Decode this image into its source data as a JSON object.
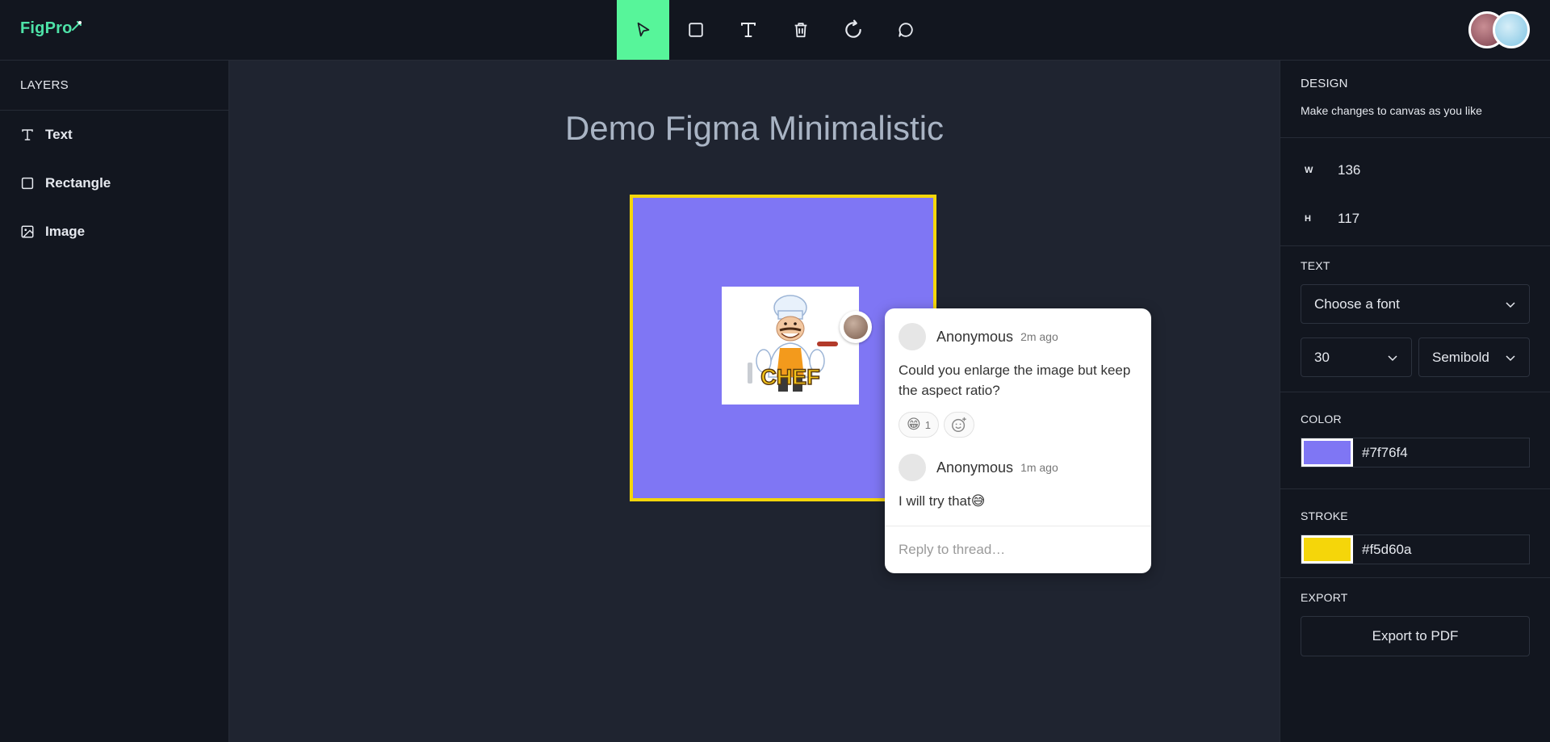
{
  "app": {
    "logo_text": "FigPro"
  },
  "toolbar": {
    "tools": [
      {
        "name": "select",
        "icon": "cursor-icon",
        "active": true
      },
      {
        "name": "rectangle",
        "icon": "square-icon"
      },
      {
        "name": "text",
        "icon": "text-icon"
      },
      {
        "name": "delete",
        "icon": "trash-icon"
      },
      {
        "name": "reset",
        "icon": "refresh-icon"
      },
      {
        "name": "comments",
        "icon": "comment-icon"
      }
    ],
    "active_color": "#57f59a"
  },
  "layers": {
    "title": "LAYERS",
    "items": [
      {
        "label": "Text",
        "icon": "text-icon"
      },
      {
        "label": "Rectangle",
        "icon": "square-icon"
      },
      {
        "label": "Image",
        "icon": "image-icon"
      }
    ]
  },
  "canvas": {
    "title": "Demo Figma Minimalistic",
    "rect_fill": "#7f76f4",
    "rect_stroke": "#f5d60a",
    "image_text": "CHEF"
  },
  "thread": {
    "comments": [
      {
        "author": "Anonymous",
        "time": "2m ago",
        "body": "Could you enlarge the image but keep the aspect ratio?"
      },
      {
        "author": "Anonymous",
        "time": "1m ago",
        "body": "I will try that😅"
      }
    ],
    "reaction": {
      "emoji": "😁",
      "count": "1"
    },
    "reply_placeholder": "Reply to thread…"
  },
  "design": {
    "title": "DESIGN",
    "subtitle": "Make changes to canvas as you like",
    "width_label": "W",
    "width": "136",
    "height_label": "H",
    "height": "117",
    "text_title": "TEXT",
    "font_placeholder": "Choose a font",
    "font_size": "30",
    "font_weight": "Semibold",
    "color_title": "COLOR",
    "fill_color": "#7f76f4",
    "stroke_title": "STROKE",
    "stroke_color": "#f5d60a",
    "export_title": "EXPORT",
    "export_label": "Export to PDF"
  }
}
